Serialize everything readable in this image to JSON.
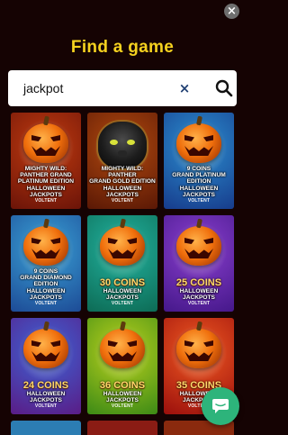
{
  "top_close_label": "×",
  "title": "Find a game",
  "search": {
    "value": "jackpot",
    "clear_label": "×"
  },
  "games": [
    {
      "lines": [
        "MIGHTY WILD:",
        "PANTHER GRAND",
        "PLATINUM EDITION",
        "HALLOWEEN",
        "JACKPOTS"
      ],
      "big": "",
      "provider": "VOLTENT",
      "bg": "#c13b10",
      "bg2": "#6b1408",
      "art": "pumpkin"
    },
    {
      "lines": [
        "MIGHTY WILD:",
        "PANTHER",
        "GRAND GOLD EDITION",
        "HALLOWEEN",
        "JACKPOTS"
      ],
      "big": "",
      "provider": "VOLTENT",
      "bg": "#b34a0f",
      "bg2": "#5a1805",
      "art": "panther"
    },
    {
      "lines": [
        "9 COINS",
        "GRAND PLATINUM",
        "EDITION",
        "HALLOWEEN",
        "JACKPOTS"
      ],
      "big": "",
      "provider": "VOLTENT",
      "bg": "#2c8fd0",
      "bg2": "#173c8c",
      "art": "pumpkin"
    },
    {
      "lines": [
        "9 COINS",
        "GRAND DIAMOND",
        "EDITION",
        "HALLOWEEN",
        "JACKPOTS"
      ],
      "big": "",
      "provider": "VOLTENT",
      "bg": "#3aa2d6",
      "bg2": "#1d4b96",
      "art": "pumpkin"
    },
    {
      "lines": [
        "HALLOWEEN",
        "JACKPOTS"
      ],
      "big": "30 COINS",
      "provider": "VOLTENT",
      "bg": "#22b3a0",
      "bg2": "#0d6b55",
      "art": "pumpkin"
    },
    {
      "lines": [
        "HALLOWEEN",
        "JACKPOTS"
      ],
      "big": "25 COINS",
      "provider": "VOLTENT",
      "bg": "#8a3fce",
      "bg2": "#45188a",
      "art": "pumpkin"
    },
    {
      "lines": [
        "HALLOWEEN",
        "JACKPOTS"
      ],
      "big": "24 COINS",
      "provider": "VOLTENT",
      "bg": "#3c64d6",
      "bg2": "#5a1c86",
      "art": "pumpkin"
    },
    {
      "lines": [
        "HALLOWEEN",
        "JACKPOTS"
      ],
      "big": "36 COINS",
      "provider": "VOLTENT",
      "bg": "#bcd21d",
      "bg2": "#3c8a16",
      "art": "pumpkin"
    },
    {
      "lines": [
        "HALLOWEEN",
        "JACKPOTS"
      ],
      "big": "35 COINS",
      "provider": "VOLTENT",
      "bg": "#f05a22",
      "bg2": "#9b0f0c",
      "art": "pumpkin"
    }
  ],
  "partial_row_colors": [
    "#2c7db3",
    "#8a1c14",
    "#8a2a0e"
  ],
  "icons": {
    "close": "close-icon",
    "clear": "clear-icon",
    "search": "search-icon",
    "chat": "chat-icon"
  },
  "colors": {
    "background": "#150303",
    "title": "#f5d21f",
    "chat": "#2db47b"
  }
}
